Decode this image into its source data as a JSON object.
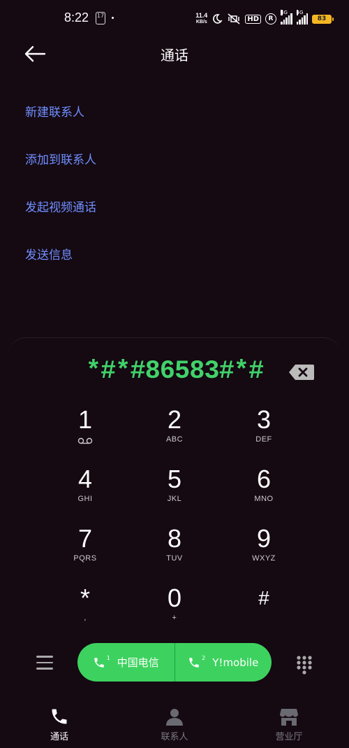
{
  "status_bar": {
    "time": "8:22",
    "notif_badge": "17",
    "net_speed_value": "11.4",
    "net_speed_unit": "KB/s",
    "hd_label": "HD",
    "sim_label_1": "4G",
    "sim_label_2": "4G",
    "battery": "83"
  },
  "header": {
    "title": "通话"
  },
  "menu": {
    "items": [
      {
        "label": "新建联系人"
      },
      {
        "label": "添加到联系人"
      },
      {
        "label": "发起视频通话"
      },
      {
        "label": "发送信息"
      }
    ]
  },
  "dialer": {
    "number": "*#*#86583#*#",
    "keys": [
      {
        "digit": "1",
        "letters": ""
      },
      {
        "digit": "2",
        "letters": "ABC"
      },
      {
        "digit": "3",
        "letters": "DEF"
      },
      {
        "digit": "4",
        "letters": "GHI"
      },
      {
        "digit": "5",
        "letters": "JKL"
      },
      {
        "digit": "6",
        "letters": "MNO"
      },
      {
        "digit": "7",
        "letters": "PQRS"
      },
      {
        "digit": "8",
        "letters": "TUV"
      },
      {
        "digit": "9",
        "letters": "WXYZ"
      },
      {
        "digit": "*",
        "letters": ","
      },
      {
        "digit": "0",
        "letters": "+"
      },
      {
        "digit": "#",
        "letters": ""
      }
    ]
  },
  "call_buttons": {
    "sim1": {
      "num": "1",
      "label": "中国电信"
    },
    "sim2": {
      "num": "2",
      "label": "Y!mobile"
    }
  },
  "bottom_nav": {
    "items": [
      {
        "label": "通话",
        "icon": "phone-icon",
        "active": true
      },
      {
        "label": "联系人",
        "icon": "person-icon",
        "active": false
      },
      {
        "label": "营业厅",
        "icon": "store-icon",
        "active": false
      }
    ]
  },
  "colors": {
    "background": "#150912",
    "accent_link": "#6f8fff",
    "dial_green": "#41d26a",
    "call_green": "#3dd25f",
    "battery": "#f5b623"
  }
}
